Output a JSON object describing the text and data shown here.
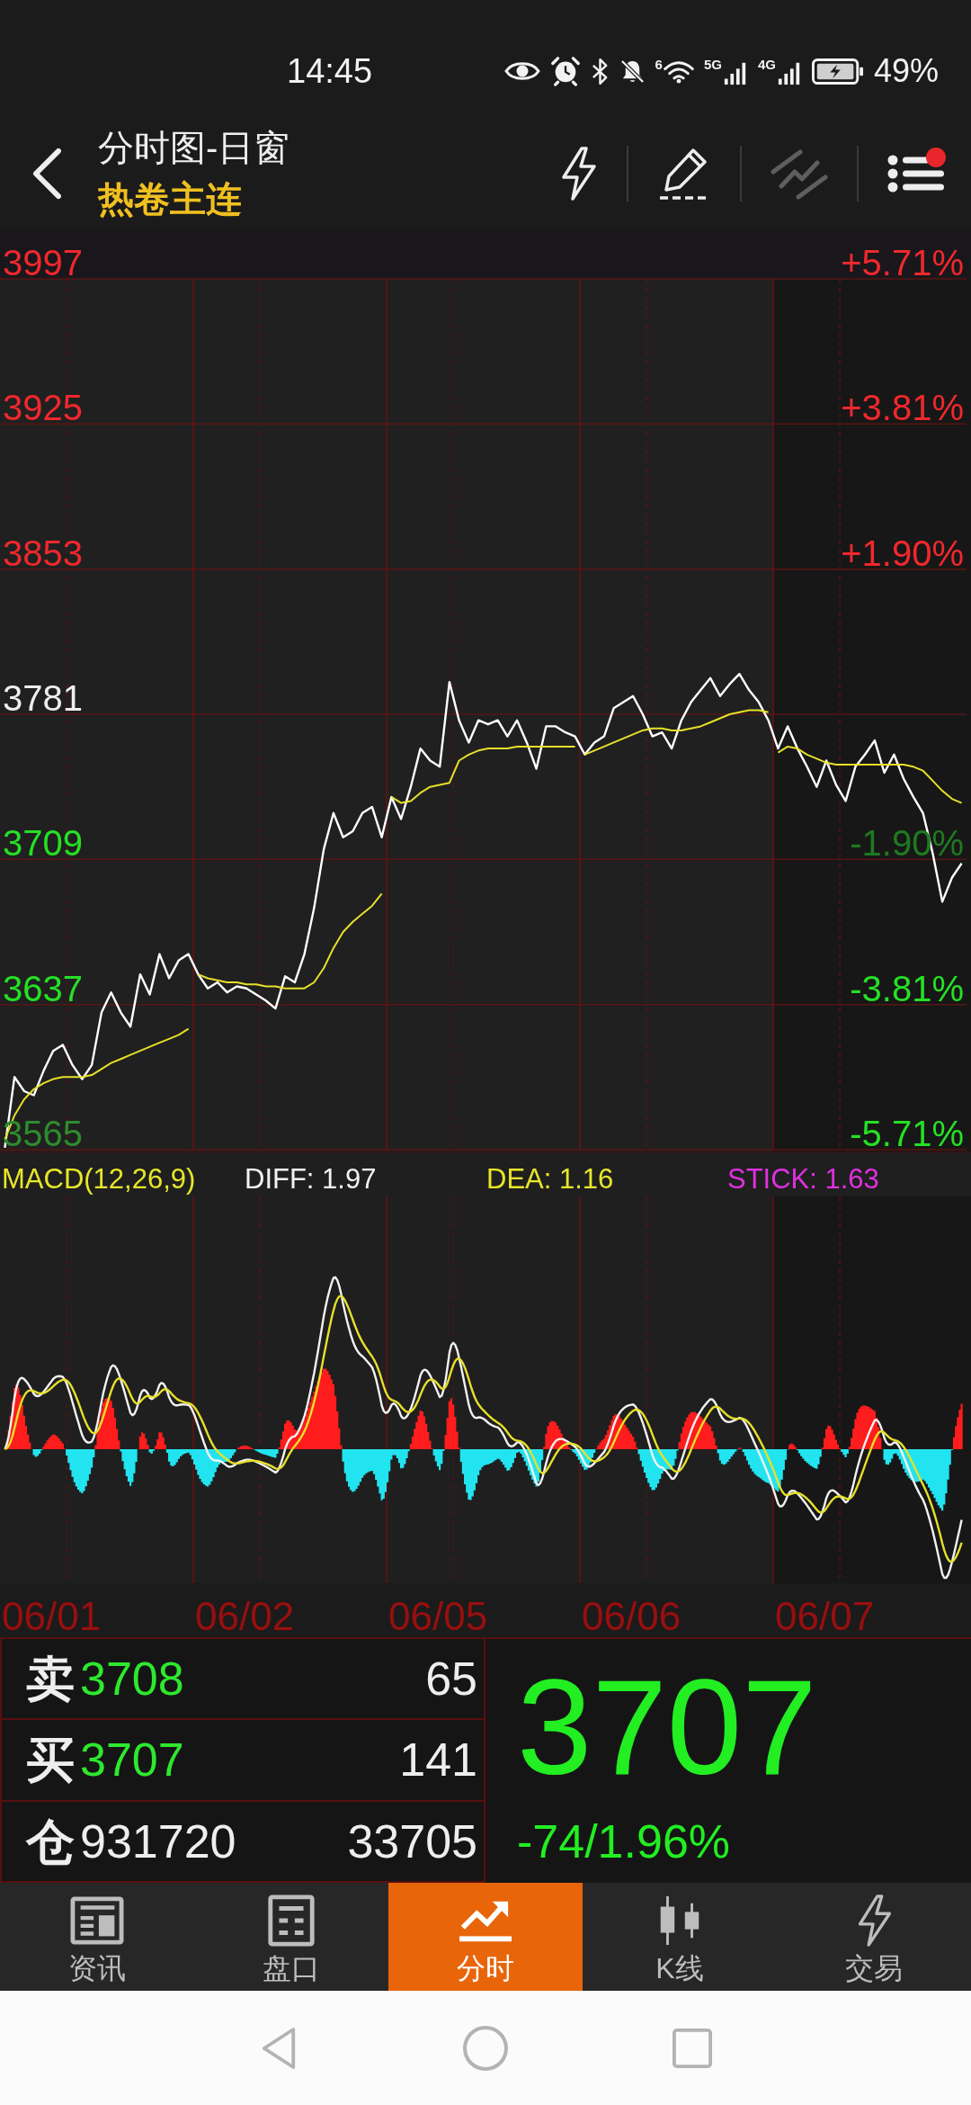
{
  "status_bar": {
    "time": "14:45",
    "wifi_label": "6",
    "signals": [
      {
        "label": "5G"
      },
      {
        "label": "4G"
      }
    ],
    "battery": "49%"
  },
  "header": {
    "title": "分时图-日窗",
    "subtitle": "热卷主连",
    "tools": [
      {
        "kind": "lightning",
        "disabled": false,
        "badge": false
      },
      {
        "kind": "pencil",
        "disabled": false,
        "badge": false
      },
      {
        "kind": "trendlines",
        "disabled": true,
        "badge": false
      },
      {
        "kind": "menu",
        "disabled": false,
        "badge": true
      }
    ]
  },
  "price_chart": {
    "left_axis": [
      {
        "color": "#f0282d"
      },
      {
        "color": "#f0282d"
      },
      {
        "color": "#f0282d"
      },
      {
        "color": "#eeeeee"
      },
      {
        "color": "#25e025"
      },
      {
        "color": "#25e025"
      },
      {
        "color": "#2e8b2e"
      }
    ],
    "right_axis": [
      {
        "label": "+5.71%",
        "color": "#f0282d"
      },
      {
        "label": "+3.81%",
        "color": "#f0282d"
      },
      {
        "label": "+1.90%",
        "color": "#f0282d"
      },
      {
        "label": "-1.90%",
        "color": "#1f7a1f"
      },
      {
        "label": "-3.81%",
        "color": "#25e025"
      },
      {
        "label": "-5.71%",
        "color": "#25e025"
      }
    ],
    "chart_data": {
      "type": "line",
      "grid": true,
      "ylim": [
        3565,
        3997
      ],
      "categories": [
        null,
        null,
        null,
        null,
        null,
        null,
        null,
        null,
        null,
        null,
        null,
        null,
        null,
        null,
        null,
        null,
        null,
        null,
        null,
        null,
        null,
        null,
        null,
        null,
        null,
        null,
        null,
        null,
        null,
        null,
        null,
        null,
        null,
        null,
        null,
        null,
        null,
        null,
        null,
        null,
        null,
        null,
        null,
        null,
        null,
        null,
        null,
        null,
        null,
        null,
        null,
        null,
        null,
        null,
        null,
        null,
        null,
        null,
        null,
        null,
        null,
        null,
        null,
        null,
        null,
        null,
        null,
        null,
        null,
        null,
        null,
        null,
        null,
        null,
        null,
        null,
        null,
        null,
        null,
        null,
        null,
        null,
        null,
        null,
        null,
        null,
        null,
        null,
        null,
        null,
        null,
        null,
        null,
        null,
        null,
        null,
        null,
        null,
        null,
        null
      ],
      "yticks": [
        {
          "value": 3997,
          "label": "3997"
        },
        {
          "value": 3925,
          "label": "3925"
        },
        {
          "value": 3853,
          "label": "3853"
        },
        {
          "value": 3781,
          "label": "3781"
        },
        {
          "value": 3709,
          "label": "3709"
        },
        {
          "value": 3637,
          "label": "3637"
        },
        {
          "value": 3565,
          "label": "3565"
        }
      ],
      "series": [
        {
          "color": "#ffffff",
          "values": [
            3566,
            3601,
            3594,
            3592,
            3604,
            3614,
            3617,
            3607,
            3600,
            3607,
            3633,
            3643,
            3633,
            3626,
            3652,
            3642,
            3662,
            3650,
            3659,
            3662,
            3652,
            3645,
            3648,
            3643,
            3646,
            3645,
            3642,
            3639,
            3635,
            3651,
            3648,
            3662,
            3685,
            3714,
            3732,
            3720,
            3723,
            3732,
            3735,
            3720,
            3740,
            3729,
            3745,
            3764,
            3758,
            3755,
            3797,
            3778,
            3767,
            3778,
            3776,
            3778,
            3770,
            3778,
            3767,
            3754,
            3775,
            3775,
            3772,
            3770,
            3761,
            3767,
            3770,
            3784,
            3787,
            3790,
            3781,
            3770,
            3772,
            3764,
            3778,
            3787,
            3793,
            3799,
            3790,
            3796,
            3801,
            3793,
            3787,
            3778,
            3764,
            3775,
            3764,
            3755,
            3745,
            3758,
            3746,
            3738,
            3755,
            3761,
            3768,
            3752,
            3761,
            3749,
            3740,
            3732,
            3712,
            3688,
            3700,
            3707
          ]
        },
        {
          "color": "#e6e02a",
          "values": [
            3570,
            3582,
            3590,
            3595,
            3598,
            3600,
            3601,
            3601,
            3601,
            3602,
            3605,
            3608,
            3610,
            3612,
            3614,
            3616,
            3618,
            3620,
            3622,
            3625,
            3652,
            3650,
            3649,
            3648,
            3648,
            3647,
            3647,
            3646,
            3646,
            3645,
            3645,
            3645,
            3648,
            3655,
            3665,
            3673,
            3678,
            3682,
            3686,
            3692,
            3740,
            3737,
            3738,
            3742,
            3745,
            3746,
            3747,
            3758,
            3761,
            3763,
            3764,
            3764,
            3764,
            3765,
            3765,
            3765,
            3765,
            3765,
            3765,
            3765,
            3761,
            3763,
            3765,
            3767,
            3769,
            3771,
            3773,
            3774,
            3774,
            3773,
            3773,
            3774,
            3775,
            3777,
            3779,
            3781,
            3782,
            3783,
            3783,
            3782,
            3762,
            3765,
            3764,
            3761,
            3759,
            3757,
            3756,
            3756,
            3756,
            3756,
            3756,
            3756,
            3756,
            3756,
            3755,
            3753,
            3748,
            3743,
            3739,
            3737
          ]
        }
      ]
    }
  },
  "macd": {
    "title": "MACD(12,26,9)",
    "diff": "DIFF: 1.97",
    "dea": "DEA: 1.16",
    "stick": "STICK: 1.63"
  },
  "date_axis": [
    "06/01",
    "06/02",
    "06/05",
    "06/06",
    "06/07"
  ],
  "quote": {
    "rows": [
      {
        "label": "卖",
        "price": "3708",
        "color": "#2ee82e",
        "volume": "65"
      },
      {
        "label": "买",
        "price": "3707",
        "color": "#2ee82e",
        "volume": "141"
      },
      {
        "label": "仓",
        "price": "931720",
        "color": "#eeeeee",
        "volume": "33705"
      }
    ],
    "last_price": "3707",
    "change": "-74/1.96%"
  },
  "bottom_nav": [
    {
      "kind": "news",
      "label": "资讯",
      "selected": false
    },
    {
      "kind": "orderbook",
      "label": "盘口",
      "selected": false
    },
    {
      "kind": "timeshare",
      "label": "分时",
      "selected": true
    },
    {
      "kind": "kline",
      "label": "K线",
      "selected": false
    },
    {
      "kind": "trade",
      "label": "交易",
      "selected": false
    }
  ]
}
